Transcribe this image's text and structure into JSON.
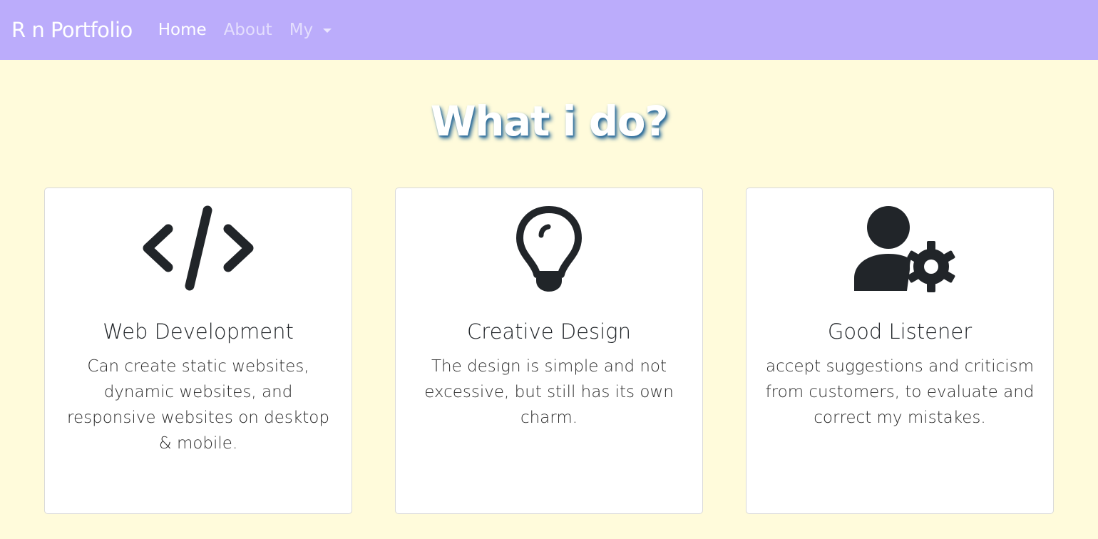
{
  "navbar": {
    "brand": "R n Portfolio",
    "links": [
      {
        "label": "Home"
      },
      {
        "label": "About"
      },
      {
        "label": "My"
      }
    ]
  },
  "section": {
    "heading": "What i do?"
  },
  "cards": [
    {
      "icon": "code-icon",
      "title": "Web Development",
      "text": "Can create static websites, dynamic websites, and responsive websites on desktop & mobile."
    },
    {
      "icon": "lightbulb-icon",
      "title": "Creative Design",
      "text": "The design is simple and not excessive, but still has its own charm."
    },
    {
      "icon": "person-gear-icon",
      "title": "Good Listener",
      "text": "accept suggestions and criticism from customers, to evaluate and correct my mistakes."
    }
  ],
  "colors": {
    "navbar_bg": "#bbacfb",
    "page_bg": "#fffbdb",
    "icon": "#212529",
    "heading_shadow": "#2f6d99"
  }
}
